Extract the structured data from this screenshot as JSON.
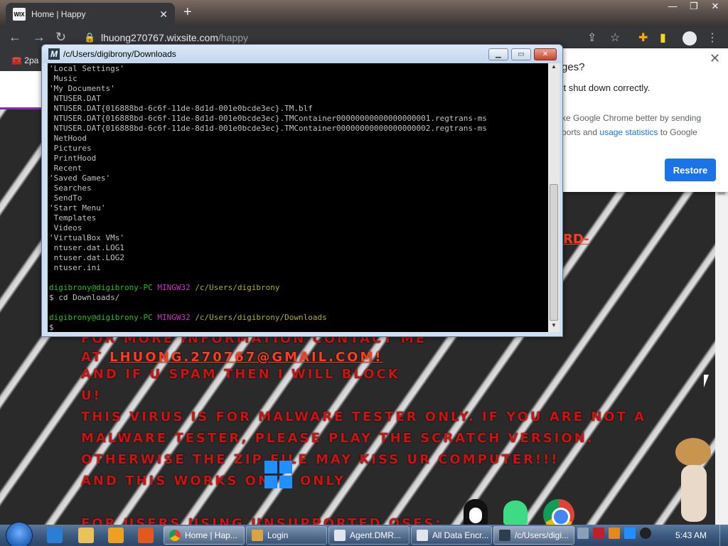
{
  "browser": {
    "tab_title": "Home | Happy",
    "tab_favicon": "WIX",
    "url_domain": "lhuong270767.wixsite.com",
    "url_path": "/happy",
    "bookmark": "2pa"
  },
  "restore_popup": {
    "title": "ges?",
    "line1": "'t shut down correctly.",
    "line2_a": "ke Google Chrome better by sending",
    "line2_b": "ports and",
    "link": "usage statistics",
    "line2_c": "to Google",
    "button": "Restore"
  },
  "site": {
    "ard": "RD-",
    "lines": [
      "FOR MORE INFORMATION CONTACT ME",
      "AT ",
      "AND IF U SPAM THEN I WILL BLOCK",
      "U!",
      "THIS VIRUS IS FOR MALWARE TESTER ONLY. IF YOU ARE NOT A",
      "MALWARE TESTER, PLEASE PLAY THE SCRATCH VERSION.",
      "OTHERWISE THE ZIP FILE MAY KISS UR COMPUTER!!!",
      "AND THIS WORKS ON",
      "ONLY",
      "FOR USERS USING UNSUPPORTED OSES:"
    ],
    "email": "LHUONG.270767@GMAIL.COM!"
  },
  "terminal": {
    "title": "/c/Users/digibrony/Downloads",
    "output": [
      "'Local Settings'",
      " Music",
      "'My Documents'",
      " NTUSER.DAT",
      " NTUSER.DAT{016888bd-6c6f-11de-8d1d-001e0bcde3ec}.TM.blf",
      " NTUSER.DAT{016888bd-6c6f-11de-8d1d-001e0bcde3ec}.TMContainer00000000000000000001.regtrans-ms",
      " NTUSER.DAT{016888bd-6c6f-11de-8d1d-001e0bcde3ec}.TMContainer00000000000000000002.regtrans-ms",
      " NetHood",
      " Pictures",
      " PrintHood",
      " Recent",
      "'Saved Games'",
      " Searches",
      " SendTo",
      "'Start Menu'",
      " Templates",
      " Videos",
      "'VirtualBox VMs'",
      " ntuser.dat.LOG1",
      " ntuser.dat.LOG2",
      " ntuser.ini"
    ],
    "prompt1": {
      "user": "digibrony@digibrony-PC",
      "sys": "MINGW32",
      "path": "/c/Users/digibrony"
    },
    "cmd1": "$ cd Downloads/",
    "prompt2": {
      "user": "digibrony@digibrony-PC",
      "sys": "MINGW32",
      "path": "/c/Users/digibrony/Downloads"
    },
    "cmd2": "$"
  },
  "taskbar": {
    "buttons": [
      {
        "label": "Home | Hap...",
        "icon": "chrome-icon"
      },
      {
        "label": "Login",
        "icon": "app-icon"
      },
      {
        "label": "Agent.DMR...",
        "icon": "app-icon"
      },
      {
        "label": "All Data Encr...",
        "icon": "app-icon"
      },
      {
        "label": "/c/Users/digi...",
        "icon": "mintty-icon"
      }
    ],
    "clock": "5:43 AM"
  },
  "colors": {
    "terminal_user": "#25bc24",
    "terminal_host": "#c930c7",
    "terminal_path": "#adad27",
    "site_text_red": "#c91414",
    "chrome_blue": "#1a73e8"
  }
}
